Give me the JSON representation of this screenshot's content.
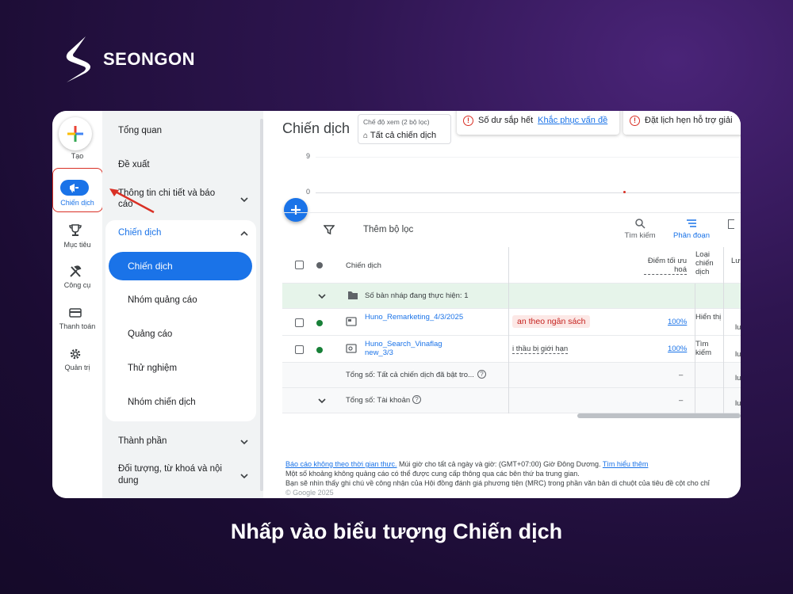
{
  "brand": {
    "name": "SEONGON"
  },
  "caption": "Nhấp vào biểu tượng Chiến dịch",
  "rail": {
    "create": "Tạo",
    "items": [
      {
        "label": "Chiến dịch",
        "icon": "megaphone-icon"
      },
      {
        "label": "Mục tiêu",
        "icon": "trophy-icon"
      },
      {
        "label": "Công cụ",
        "icon": "tools-icon"
      },
      {
        "label": "Thanh toán",
        "icon": "credit-card-icon"
      },
      {
        "label": "Quản trị",
        "icon": "gear-icon"
      }
    ]
  },
  "nav": {
    "overview": "Tổng quan",
    "recommendations": "Đề xuất",
    "insights": "Thông tin chi tiết và báo cáo",
    "group_title": "Chiến dịch",
    "sub_items": [
      "Chiến dịch",
      "Nhóm quảng cáo",
      "Quảng cáo",
      "Thử nghiệm",
      "Nhóm chiến dịch"
    ],
    "components": "Thành phần",
    "audiences": "Đối tượng, từ khoá và nội dung"
  },
  "main": {
    "title": "Chiến dịch",
    "view_mode_caption": "Chế độ xem (2 bộ lọc)",
    "view_mode_value": "Tất cả chiến dịch",
    "alert1_text": "Số dư sắp hết",
    "alert1_link": "Khắc phục vấn đề",
    "alert2_text": "Đặt lịch hẹn hỗ trợ giải",
    "chart_y_top": "9",
    "chart_y_zero": "0",
    "add_filter": "Thêm bộ lọc",
    "search": "Tìm kiếm",
    "segment": "Phân đoạn"
  },
  "table": {
    "headers": {
      "campaign": "Chiến dịch",
      "optimization": "Điểm tối ưu hoá",
      "type": "Loại chiến dịch",
      "next": "Lượ"
    },
    "draft_row": "Số bản nháp đang thực hiện: 1",
    "rows": [
      {
        "name": "Huno_Remarketing_4/3/2025",
        "status_badge": "an theo ngân sách",
        "score": "100%",
        "type": "Hiển thị",
        "next": "lu"
      },
      {
        "name": "Huno_Search_Vinaflag new_3/3",
        "status_note": "i thầu bị giới hạn",
        "score": "100%",
        "type": "Tìm kiếm",
        "next": "lu"
      }
    ],
    "total_enabled": "Tổng số: Tất cả chiến dịch đã bật tro...",
    "total_account": "Tổng số: Tài khoản",
    "dash": "–",
    "next_total": "lu"
  },
  "footer": {
    "line1_link": "Báo cáo không theo thời gian thực.",
    "line1_text": "Múi giờ cho tất cả ngày và giờ: (GMT+07:00) Giờ Đông Dương.",
    "line1_link2": "Tìm hiểu thêm",
    "line2": "Một số khoảng không quảng cáo có thể được cung cấp thông qua các bên thứ ba trung gian.",
    "line3": "Bạn sẽ nhìn thấy ghi chú về công nhận của Hội đồng đánh giá phương tiện (MRC) trong phần văn bản di chuột của tiêu đề cột cho chỉ",
    "line4": "© Google 2025"
  },
  "colors": {
    "accent": "#1a73e8",
    "highlight": "#d93025",
    "status_green": "#188038"
  }
}
